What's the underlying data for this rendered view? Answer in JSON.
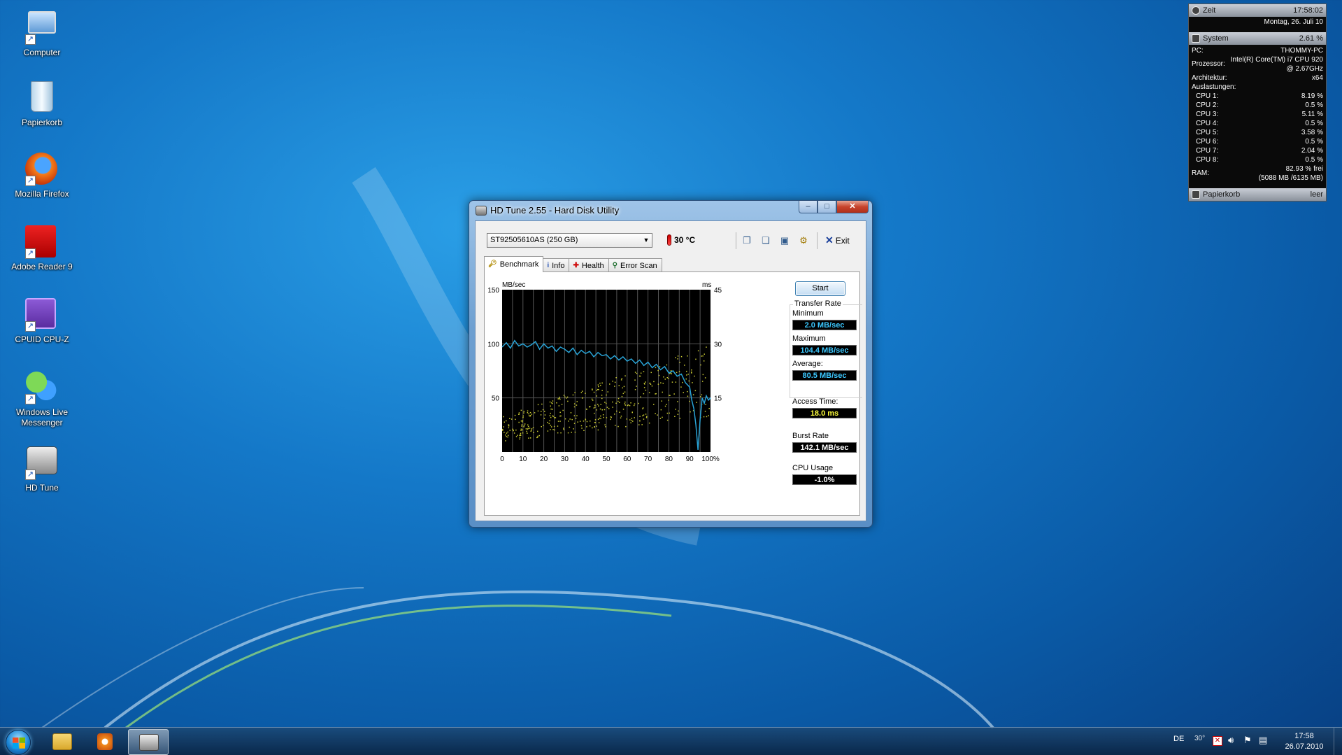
{
  "desktop": {
    "icons": [
      {
        "label": "Computer",
        "icon": "computer-icon"
      },
      {
        "label": "Papierkorb",
        "icon": "recycle-bin-icon"
      },
      {
        "label": "Mozilla Firefox",
        "icon": "firefox-icon"
      },
      {
        "label": "Adobe Reader 9",
        "icon": "adobe-reader-icon"
      },
      {
        "label": "CPUID CPU-Z",
        "icon": "cpuz-icon"
      },
      {
        "label": "Windows Live Messenger",
        "icon": "messenger-icon"
      },
      {
        "label": "HD Tune",
        "icon": "hdtune-icon"
      }
    ]
  },
  "gadget": {
    "clock": {
      "title": "Zeit",
      "time": "17:58:02",
      "date": "Montag, 26. Juli 10"
    },
    "system": {
      "title": "System",
      "load": "2.61 %",
      "pc_label": "PC:",
      "pc": "THOMMY-PC",
      "cpu_label": "Prozessor:",
      "cpu_line1": "Intel(R) Core(TM) i7 CPU 920",
      "cpu_line2": "@ 2.67GHz",
      "arch_label": "Architektur:",
      "arch": "x64",
      "load_label": "Auslastungen:",
      "cores": [
        {
          "name": "CPU 1:",
          "value": "8.19 %"
        },
        {
          "name": "CPU 2:",
          "value": "0.5 %"
        },
        {
          "name": "CPU 3:",
          "value": "5.11 %"
        },
        {
          "name": "CPU 4:",
          "value": "0.5 %"
        },
        {
          "name": "CPU 5:",
          "value": "3.58 %"
        },
        {
          "name": "CPU 6:",
          "value": "0.5 %"
        },
        {
          "name": "CPU 7:",
          "value": "2.04 %"
        },
        {
          "name": "CPU 8:",
          "value": "0.5 %"
        }
      ],
      "ram_label": "RAM:",
      "ram_line1": "82.93 % frei",
      "ram_line2": "(5088 MB /6135 MB)"
    },
    "recycle": {
      "title": "Papierkorb",
      "status": "leer"
    }
  },
  "window": {
    "title": "HD Tune 2.55 - Hard Disk Utility",
    "drive": "ST92505610AS (250 GB)",
    "temperature": "30 °C",
    "exit_label": "Exit",
    "tabs": [
      {
        "label": "Benchmark",
        "icon": "benchmark-icon"
      },
      {
        "label": "Info",
        "icon": "info-icon"
      },
      {
        "label": "Health",
        "icon": "health-icon"
      },
      {
        "label": "Error Scan",
        "icon": "error-scan-icon"
      }
    ],
    "start_label": "Start",
    "stats": {
      "transfer_rate_label": "Transfer Rate",
      "minimum_label": "Minimum",
      "minimum": "2.0 MB/sec",
      "maximum_label": "Maximum",
      "maximum": "104.4 MB/sec",
      "average_label": "Average:",
      "average": "80.5 MB/sec",
      "access_label": "Access Time:",
      "access": "18.0 ms",
      "burst_label": "Burst Rate",
      "burst": "142.1 MB/sec",
      "cpu_label": "CPU Usage",
      "cpu": "-1.0%"
    },
    "colors": {
      "transfer": "#29a3d6",
      "access": "#c8c832",
      "value_blue": "#3cc8ff",
      "value_yellow": "#ffff3c",
      "value_white": "#ffffff"
    }
  },
  "chart_data": {
    "type": "line",
    "y_left_label": "MB/sec",
    "y_right_label": "ms",
    "x_ticks": [
      "0",
      "10",
      "20",
      "30",
      "40",
      "50",
      "60",
      "70",
      "80",
      "90",
      "100%"
    ],
    "y_left_ticks": [
      "150",
      "100",
      "50"
    ],
    "y_right_ticks": [
      "45",
      "30",
      "15"
    ],
    "ylim_left": [
      0,
      150
    ],
    "ylim_right": [
      0,
      45
    ],
    "xlim": [
      0,
      100
    ],
    "grid": true,
    "series": [
      {
        "name": "Transfer Rate",
        "x": [
          0,
          2,
          4,
          6,
          8,
          10,
          12,
          14,
          16,
          18,
          20,
          22,
          24,
          26,
          28,
          30,
          32,
          34,
          36,
          38,
          40,
          42,
          44,
          46,
          48,
          50,
          52,
          54,
          56,
          58,
          60,
          62,
          64,
          66,
          68,
          70,
          72,
          74,
          76,
          78,
          80,
          82,
          84,
          86,
          88,
          90,
          91,
          92,
          93,
          94,
          95,
          96,
          97,
          98,
          99,
          100
        ],
        "y": [
          97,
          101,
          96,
          103,
          98,
          100,
          97,
          99,
          102,
          95,
          100,
          96,
          98,
          93,
          97,
          95,
          92,
          96,
          90,
          94,
          91,
          93,
          88,
          92,
          89,
          90,
          86,
          89,
          85,
          88,
          84,
          86,
          82,
          85,
          80,
          83,
          78,
          81,
          76,
          79,
          73,
          75,
          70,
          72,
          64,
          60,
          48,
          40,
          25,
          2,
          30,
          50,
          45,
          52,
          48,
          50
        ]
      },
      {
        "name": "Access Time",
        "type": "scatter",
        "ms_min_start": 3,
        "ms_max_start": 10,
        "ms_min_end": 10,
        "ms_max_end": 30
      }
    ]
  },
  "taskbar": {
    "lang": "DE",
    "tray_temp": "30°",
    "time": "17:58",
    "date": "26.07.2010",
    "apps": [
      {
        "name": "explorer",
        "icon": "folder-icon"
      },
      {
        "name": "media player",
        "icon": "media-player-icon"
      },
      {
        "name": "hd tune",
        "icon": "hdtune-icon"
      }
    ]
  }
}
